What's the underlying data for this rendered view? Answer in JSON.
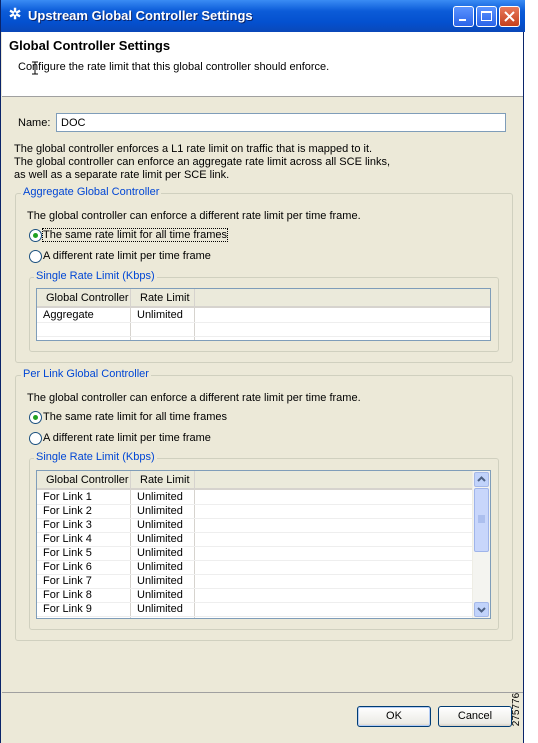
{
  "window": {
    "title": "Upstream Global Controller Settings"
  },
  "header": {
    "title": "Global Controller Settings",
    "description": "Configure the rate limit that this global controller should enforce."
  },
  "name_field": {
    "label": "Name:",
    "value": "DOC"
  },
  "intro_text": [
    "The global controller enforces a L1 rate limit on traffic that is mapped to it.",
    "The global controller can enforce an aggregate rate limit across all SCE links,",
    "as well as a separate rate limit per SCE link."
  ],
  "aggregate_group": {
    "title": "Aggregate Global Controller",
    "description": "The global controller can enforce a different rate limit per time frame.",
    "radio_same": "The same rate limit for all time frames",
    "radio_different": "A different rate limit per time frame",
    "selected": "same",
    "table_group_title": "Single Rate Limit (Kbps)",
    "columns": [
      "Global Controller",
      "Rate Limit"
    ],
    "rows": [
      {
        "controller": "Aggregate",
        "limit": "Unlimited"
      }
    ]
  },
  "per_link_group": {
    "title": "Per Link Global Controller",
    "description": "The global controller can enforce a different rate limit per time frame.",
    "radio_same": "The same rate limit for all time frames",
    "radio_different": "A different rate limit per time frame",
    "selected": "same",
    "table_group_title": "Single Rate Limit (Kbps)",
    "columns": [
      "Global Controller",
      "Rate Limit"
    ],
    "rows": [
      {
        "controller": "For Link 1",
        "limit": "Unlimited"
      },
      {
        "controller": "For Link 2",
        "limit": "Unlimited"
      },
      {
        "controller": "For Link 3",
        "limit": "Unlimited"
      },
      {
        "controller": "For Link 4",
        "limit": "Unlimited"
      },
      {
        "controller": "For Link 5",
        "limit": "Unlimited"
      },
      {
        "controller": "For Link 6",
        "limit": "Unlimited"
      },
      {
        "controller": "For Link 7",
        "limit": "Unlimited"
      },
      {
        "controller": "For Link 8",
        "limit": "Unlimited"
      },
      {
        "controller": "For Link 9",
        "limit": "Unlimited"
      }
    ]
  },
  "buttons": {
    "ok": "OK",
    "cancel": "Cancel"
  },
  "figure_id": "275776",
  "icons": {
    "app": "cisco-sce-icon",
    "minimize": "minimize-icon",
    "maximize": "maximize-icon",
    "close": "close-icon",
    "scroll_up": "arrow-up-icon",
    "scroll_down": "arrow-down-icon"
  },
  "colors": {
    "title_bar": "#0450cf",
    "group_label": "#0046d5",
    "radio_selected": "#21a121",
    "dialog_bg": "#ece9d8"
  }
}
